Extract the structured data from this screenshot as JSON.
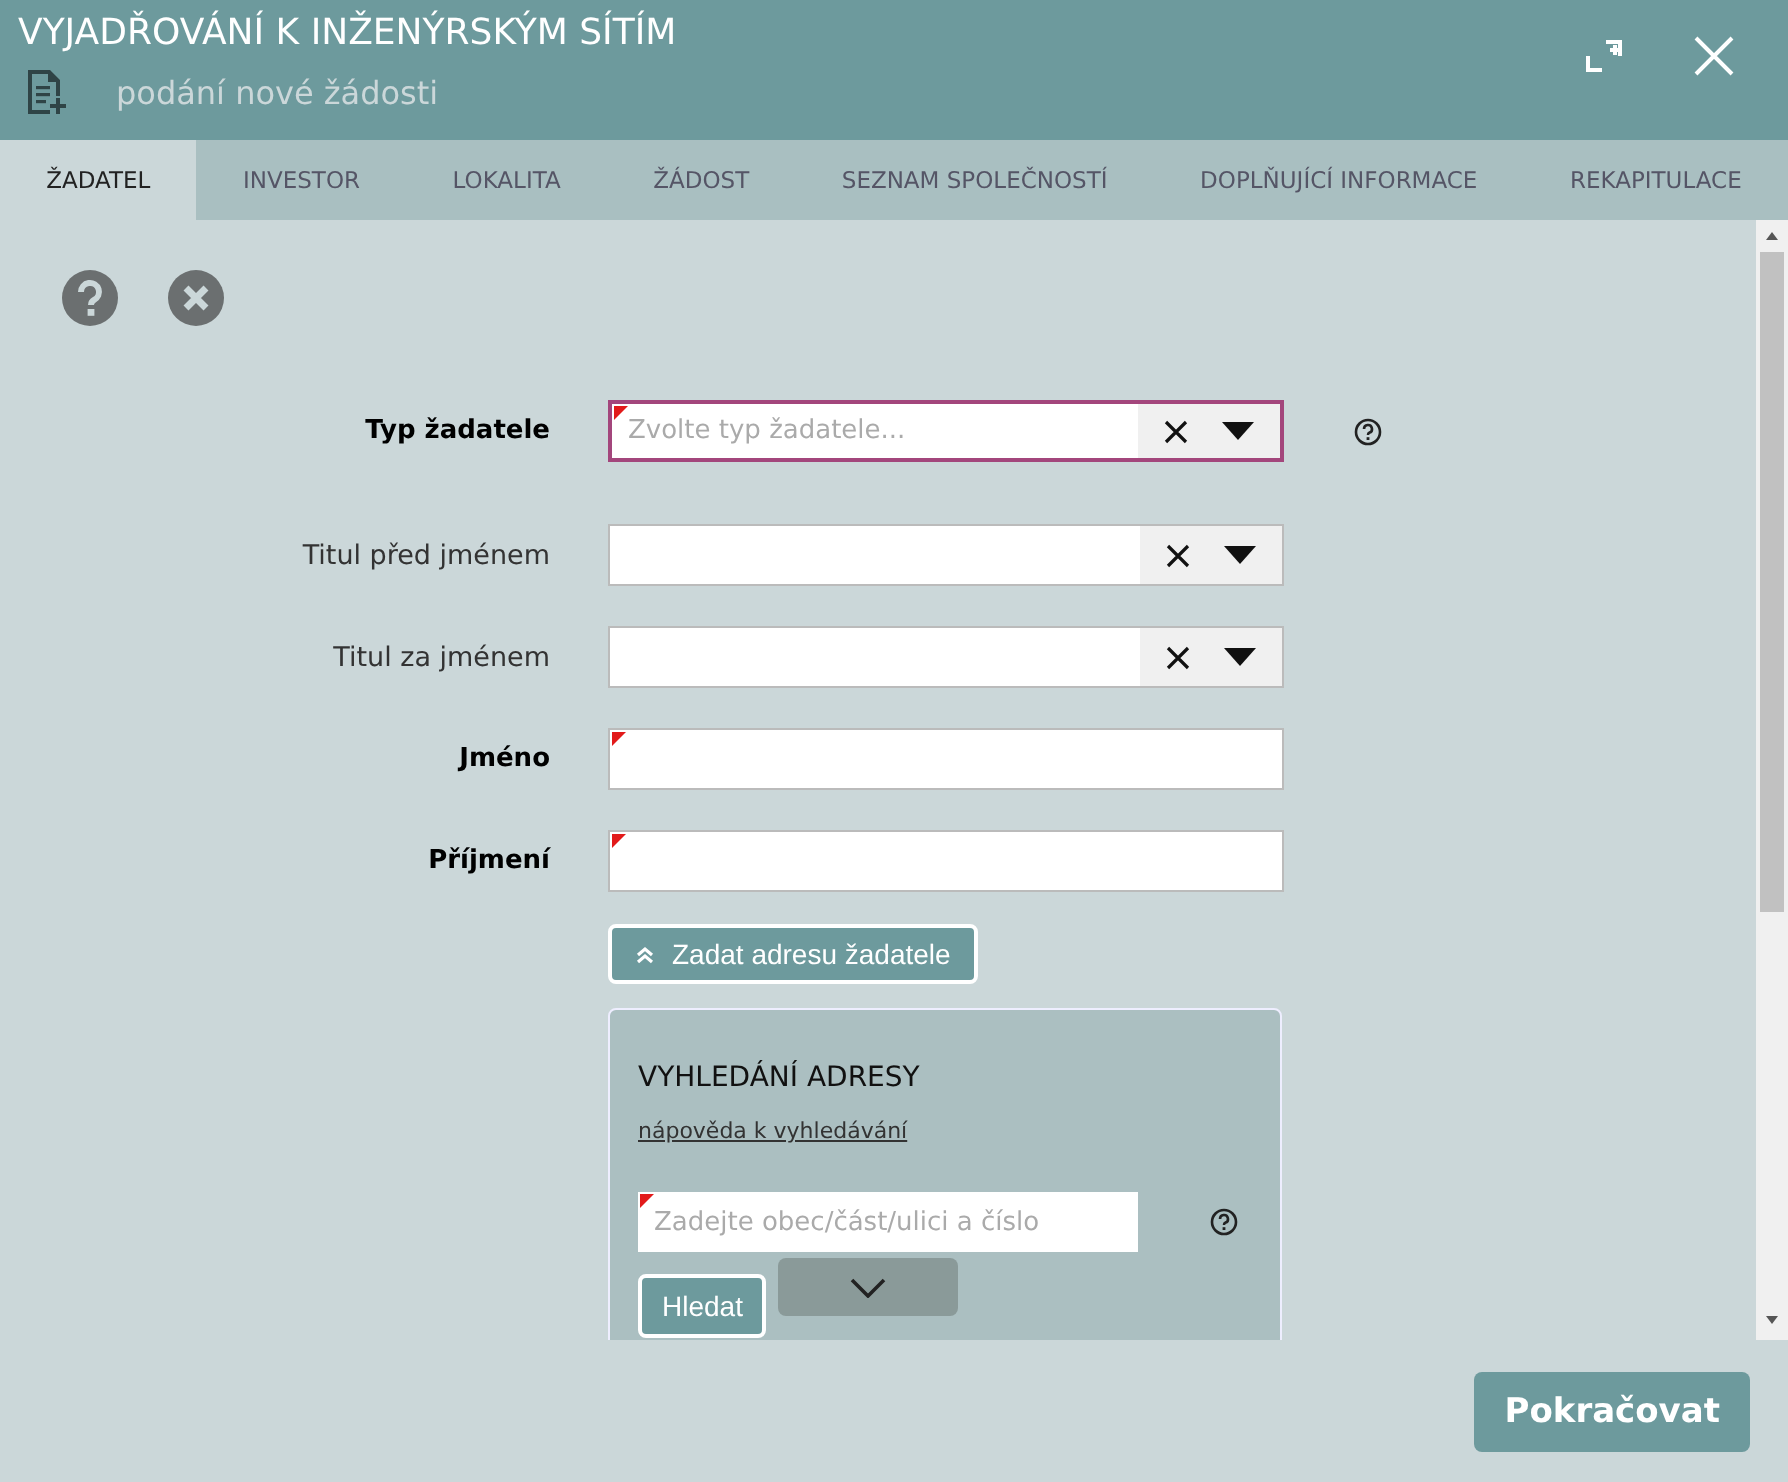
{
  "window": {
    "title": "VYJADŘOVÁNÍ K INŽENÝRSKÝM SÍTÍM",
    "subtitle": "podání nové žádosti"
  },
  "tabs": [
    {
      "label": "ŽADATEL",
      "selected": true
    },
    {
      "label": "INVESTOR",
      "selected": false
    },
    {
      "label": "LOKALITA",
      "selected": false
    },
    {
      "label": "ŽÁDOST",
      "selected": false
    },
    {
      "label": "SEZNAM SPOLEČNOSTÍ",
      "selected": false
    },
    {
      "label": "DOPLŇUJÍCÍ INFORMACE",
      "selected": false
    },
    {
      "label": "REKAPITULACE",
      "selected": false
    }
  ],
  "fields": [
    {
      "label": "Typ žadatele",
      "kind": "select",
      "required": true,
      "focused": true,
      "placeholder": "Zvolte typ žadatele...",
      "help": true
    },
    {
      "label": "Titul před jménem",
      "kind": "select",
      "required": false,
      "focused": false,
      "help": false
    },
    {
      "label": "Titul za jménem",
      "kind": "select",
      "required": false,
      "focused": false,
      "help": false
    },
    {
      "label": "Jméno",
      "kind": "text",
      "required": true,
      "focused": false,
      "help": false
    },
    {
      "label": "Příjmení",
      "kind": "text",
      "required": true,
      "focused": false,
      "help": false
    }
  ],
  "address_toggle": {
    "label": "Zadat adresu žadatele",
    "expanded": true
  },
  "address_search": {
    "title": "VYHLEDÁNÍ ADRESY",
    "help_link": "nápověda k vyhledávání",
    "placeholder": "Zadejte obec/část/ulici a číslo",
    "required": true,
    "search_button": "Hledat"
  },
  "continue_button": "Pokračovat"
}
